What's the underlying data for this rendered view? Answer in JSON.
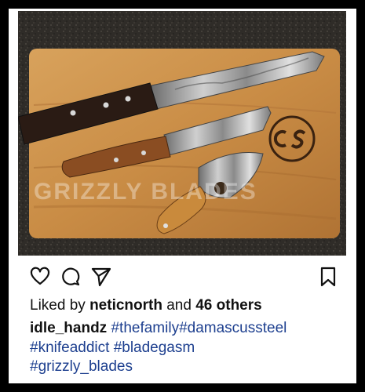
{
  "post": {
    "image_alt": "Damascus steel knives on a wooden cutting board",
    "watermark": "GRIZZLY BLADES",
    "board_logo": "CS",
    "actions": {
      "like_icon": "heart-icon",
      "comment_icon": "comment-icon",
      "share_icon": "send-icon",
      "save_icon": "bookmark-icon"
    },
    "likes": {
      "prefix": "Liked by",
      "user": "neticnorth",
      "middle": "and",
      "others": "46 others"
    },
    "caption": {
      "username": "idle_handz",
      "tags": [
        "#thefamily",
        "#damascussteel",
        "#knifeaddict",
        "#bladegasm",
        "#grizzly_blades"
      ]
    }
  },
  "colors": {
    "frame": "#000000",
    "hashtag": "#1d3f8f",
    "text": "#111111"
  }
}
